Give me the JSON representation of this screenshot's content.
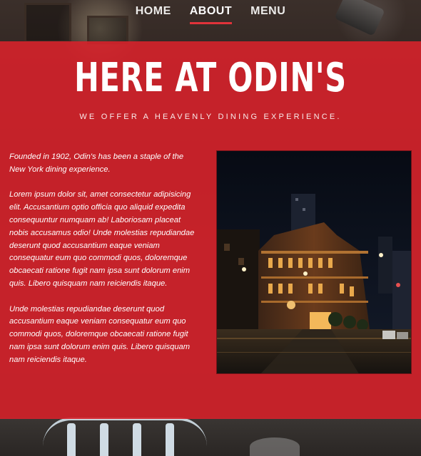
{
  "nav": {
    "items": [
      {
        "label": "HOME",
        "active": false
      },
      {
        "label": "ABOUT",
        "active": true
      },
      {
        "label": "MENU",
        "active": false
      }
    ],
    "accent_color": "#e0333a"
  },
  "hero": {
    "title": "HERE AT ODIN'S",
    "tagline": "WE OFFER A HEAVENLY DINING EXPERIENCE."
  },
  "about": {
    "paragraphs": [
      "Founded in 1902, Odin's has been a staple of the New York dining experience.",
      "Lorem ipsum dolor sit, amet consectetur adipisicing elit. Accusantium optio officia quo aliquid expedita consequuntur numquam ab! Laboriosam placeat nobis accusamus odio! Unde molestias repudiandae deserunt quod accusantium eaque veniam consequatur eum quo commodi quos, doloremque obcaecati ratione fugit nam ipsa sunt dolorum enim quis. Libero quisquam nam reiciendis itaque.",
      "Unde molestias repudiandae deserunt quod accusantium eaque veniam consequatur eum quo commodi quos, doloremque obcaecati ratione fugit nam ipsa sunt dolorum enim quis. Libero quisquam nam reiciendis itaque."
    ]
  },
  "theme": {
    "panel_color": "#d6222b"
  }
}
